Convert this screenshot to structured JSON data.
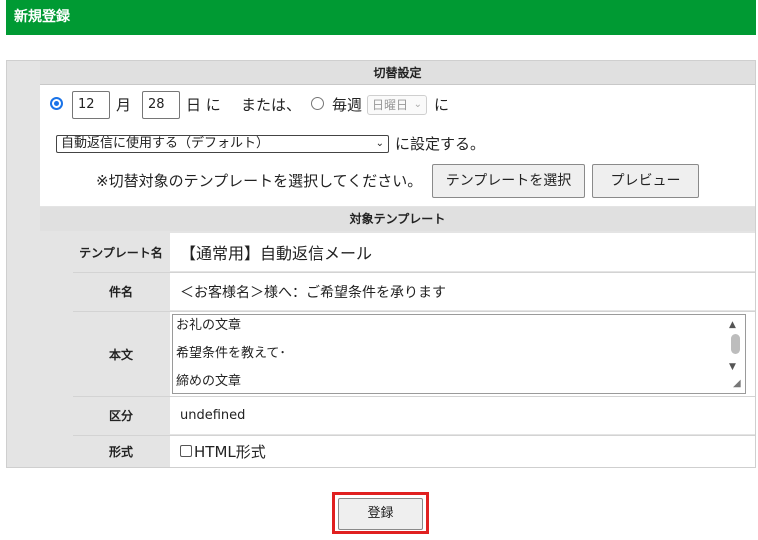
{
  "header": {
    "title": "新規登録"
  },
  "switch_settings": {
    "title": "切替設定",
    "month_value": "12",
    "month_label": "月",
    "day_value": "28",
    "day_label": "日 に",
    "or_label": "または、",
    "weekly_label": "毎週",
    "weekday_select": "日曜日",
    "ni_label": "に",
    "mode_select": "自動返信に使用する（デフォルト）",
    "set_label": "に設定する。",
    "instruction": "※切替対象のテンプレートを選択してください。",
    "select_template_button": "テンプレートを選択",
    "preview_button": "プレビュー"
  },
  "template": {
    "title": "対象テンプレート",
    "name_label": "テンプレート名",
    "name_value": "【通常用】自動返信メール",
    "subject_label": "件名",
    "subject_value": "＜お客様名＞様へ：ご希望条件を承ります",
    "body_label": "本文",
    "body_lines": [
      "お礼の文章",
      "希望条件を教えて･",
      "締めの文章"
    ],
    "category_label": "区分",
    "category_value": "undefined",
    "format_label": "形式",
    "format_checkbox_label": "HTML形式",
    "format_checked": false
  },
  "footer": {
    "register_button": "登録"
  }
}
